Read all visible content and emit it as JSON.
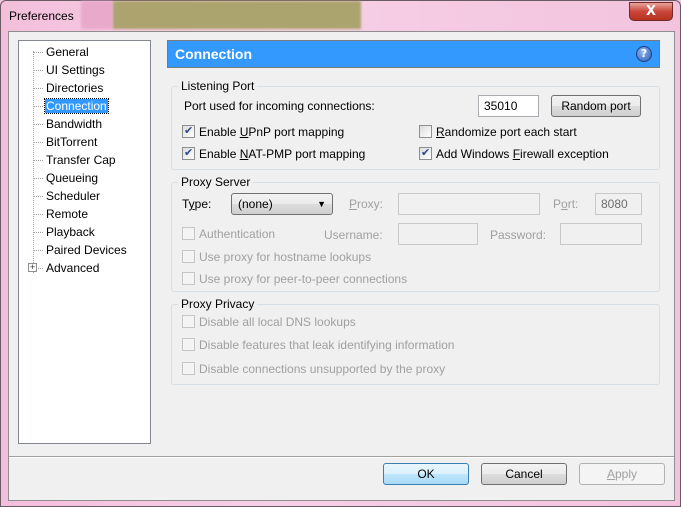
{
  "window": {
    "title": "Preferences",
    "close_label": "X"
  },
  "sidebar": {
    "items": [
      {
        "label": "General",
        "selected": false
      },
      {
        "label": "UI Settings",
        "selected": false
      },
      {
        "label": "Directories",
        "selected": false
      },
      {
        "label": "Connection",
        "selected": true
      },
      {
        "label": "Bandwidth",
        "selected": false
      },
      {
        "label": "BitTorrent",
        "selected": false
      },
      {
        "label": "Transfer Cap",
        "selected": false
      },
      {
        "label": "Queueing",
        "selected": false
      },
      {
        "label": "Scheduler",
        "selected": false
      },
      {
        "label": "Remote",
        "selected": false
      },
      {
        "label": "Playback",
        "selected": false
      },
      {
        "label": "Paired Devices",
        "selected": false
      },
      {
        "label": "Advanced",
        "selected": false,
        "expandable": true
      }
    ],
    "expander_glyph": "+"
  },
  "header": {
    "title": "Connection",
    "help_glyph": "?"
  },
  "listening_port": {
    "title": "Listening Port",
    "port_label": "Port used for incoming connections:",
    "port_value": "35010",
    "random_port_button": "Random port",
    "upnp": {
      "pre": "Enable ",
      "key": "U",
      "post": "PnP port mapping",
      "checked": true
    },
    "natpmp": {
      "pre": "Enable ",
      "key": "N",
      "post": "AT-PMP port mapping",
      "checked": true
    },
    "randomize": {
      "pre": "",
      "key": "R",
      "post": "andomize port each start",
      "checked": false
    },
    "firewall": {
      "pre": "Add Windows ",
      "key": "F",
      "post": "irewall exception",
      "checked": true
    }
  },
  "proxy_server": {
    "title": "Proxy Server",
    "type_label_pre": "T",
    "type_label_key": "y",
    "type_label_post": "pe:",
    "type_value": "(none)",
    "proxy_label_key": "P",
    "proxy_label_post": "roxy:",
    "proxy_value": "",
    "port_label_pre": "P",
    "port_label_key": "o",
    "port_label_post": "rt:",
    "port_value": "8080",
    "authentication": {
      "label": "Authentication",
      "checked": false
    },
    "username_label": "Username:",
    "username_value": "",
    "password_label": "Password:",
    "password_value": "",
    "hostname_lookups": {
      "label": "Use proxy for hostname lookups",
      "checked": false
    },
    "p2p_connections": {
      "label": "Use proxy for peer-to-peer connections",
      "checked": false
    }
  },
  "proxy_privacy": {
    "title": "Proxy Privacy",
    "disable_dns": {
      "label": "Disable all local DNS lookups",
      "checked": false
    },
    "disable_leak": {
      "label": "Disable features that leak identifying information",
      "checked": false
    },
    "disable_unsupported": {
      "label": "Disable connections unsupported by the proxy",
      "checked": false
    }
  },
  "footer": {
    "ok": "OK",
    "cancel": "Cancel",
    "apply_key": "A",
    "apply_post": "pply"
  },
  "colors": {
    "accent": "#3399ff",
    "titlebar": "#f3c3de",
    "close_button": "#c9463a"
  }
}
